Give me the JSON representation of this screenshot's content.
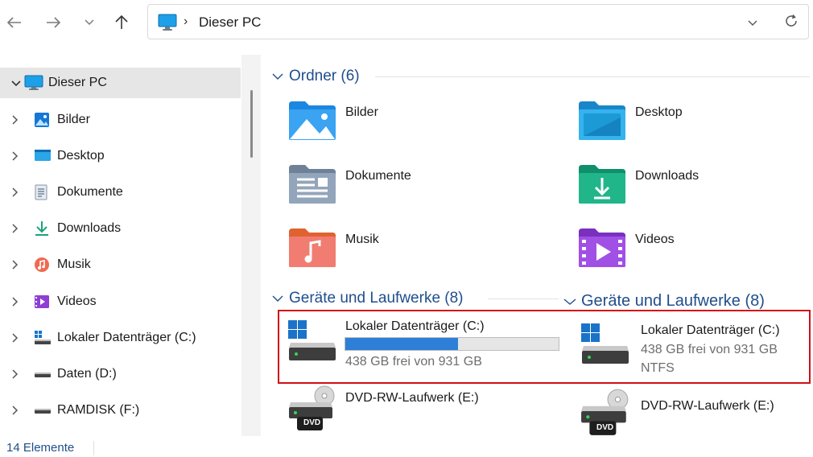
{
  "toolbar": {
    "back_icon": "arrow-left-icon",
    "forward_icon": "arrow-right-icon",
    "recent_icon": "chevron-down-icon",
    "up_icon": "arrow-up-icon"
  },
  "address": {
    "path": "Dieser PC",
    "separator": "›"
  },
  "sidebar": {
    "items": [
      {
        "label": "Dieser PC",
        "icon": "monitor-icon"
      },
      {
        "label": "Bilder",
        "icon": "pictures-icon"
      },
      {
        "label": "Desktop",
        "icon": "desktop-icon"
      },
      {
        "label": "Dokumente",
        "icon": "documents-icon"
      },
      {
        "label": "Downloads",
        "icon": "download-icon"
      },
      {
        "label": "Musik",
        "icon": "music-icon"
      },
      {
        "label": "Videos",
        "icon": "videos-icon"
      },
      {
        "label": "Lokaler Datenträger (C:)",
        "icon": "system-drive-icon"
      },
      {
        "label": "Daten (D:)",
        "icon": "drive-icon"
      },
      {
        "label": "RAMDISK (F:)",
        "icon": "drive-icon"
      }
    ]
  },
  "groups": {
    "folders_header": "Ordner (6)",
    "devices_header": "Geräte und Laufwerke (8)",
    "devices_header_overlay": "Geräte und Laufwerke (8)"
  },
  "folders": [
    {
      "label": "Bilder",
      "icon": "pictures-folder-icon"
    },
    {
      "label": "Desktop",
      "icon": "desktop-folder-icon"
    },
    {
      "label": "Dokumente",
      "icon": "documents-folder-icon"
    },
    {
      "label": "Downloads",
      "icon": "downloads-folder-icon"
    },
    {
      "label": "Musik",
      "icon": "music-folder-icon"
    },
    {
      "label": "Videos",
      "icon": "videos-folder-icon"
    }
  ],
  "drives": {
    "c_drive": {
      "label": "Lokaler Datenträger (C:)",
      "free_text": "438 GB frei von 931 GB",
      "used_fraction": 0.53
    },
    "c_drive_overlay": {
      "label": "Lokaler Datenträger (C:)",
      "free_text": "438 GB frei von 931 GB",
      "fs": "NTFS"
    },
    "dvd": {
      "label": "DVD-RW-Laufwerk (E:)",
      "badge": "DVD"
    },
    "dvd_overlay": {
      "label": "DVD-RW-Laufwerk (E:)",
      "badge": "DVD"
    }
  },
  "status": {
    "count": "14 Elemente"
  },
  "colors": {
    "accent": "#1f4e8c",
    "highlight_box": "#d10f17",
    "usage_bar": "#2d7fd8"
  }
}
